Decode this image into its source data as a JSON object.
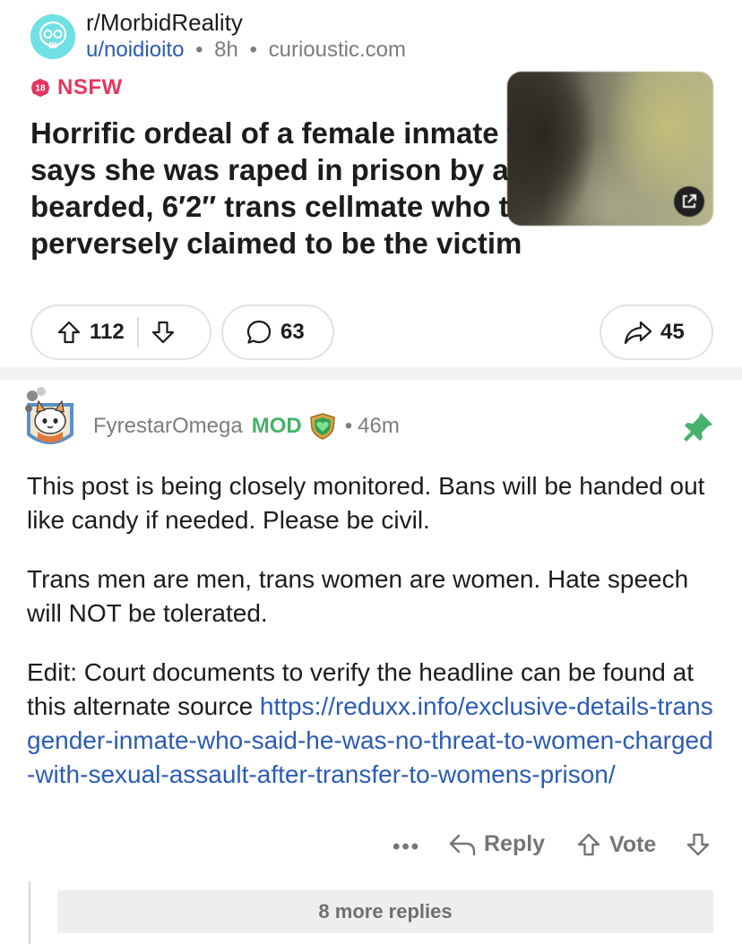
{
  "post": {
    "subreddit": "r/MorbidReality",
    "author": "u/noidioito",
    "age": "8h",
    "domain": "curioustic.com",
    "separator": "•",
    "nsfw_badge": "18",
    "nsfw_label": "NSFW",
    "title": "Horrific ordeal of a female inmate who says she was raped in prison by a bearded, 6′2″ trans cellmate who then perversely claimed to be the victim",
    "upvotes": "112",
    "comments": "63",
    "shares": "45"
  },
  "comment": {
    "username": "FyrestarOmega",
    "mod_label": "MOD",
    "separator": "•",
    "age": "46m",
    "paragraph1": "This post is being closely monitored. Bans will be handed out like candy if needed.  Please be civil.",
    "paragraph2": "Trans men are men, trans women are women. Hate speech will NOT be tolerated.",
    "paragraph3_text": "Edit: Court documents to verify the headline can be found at this alternate source ",
    "paragraph3_link": "https://reduxx.info/exclusive-details-transgender-inmate-who-said-he-was-no-threat-to-women-charged-with-sexual-assault-after-transfer-to-womens-prison/",
    "more_label": "•••",
    "reply_label": "Reply",
    "vote_label": "Vote",
    "more_replies": "8 more replies"
  },
  "colors": {
    "link": "#2b5bb5",
    "nsfw": "#e6355f",
    "mod": "#46b26b",
    "pin": "#46b26b",
    "subreddit_avatar": "#6fe0e4"
  },
  "icons": [
    "skull-icon",
    "nsfw-18-icon",
    "external-link-icon",
    "upvote-arrow-icon",
    "downvote-arrow-icon",
    "comment-bubble-icon",
    "share-arrow-icon",
    "mod-shield-icon",
    "pin-icon",
    "reply-arrow-icon"
  ]
}
